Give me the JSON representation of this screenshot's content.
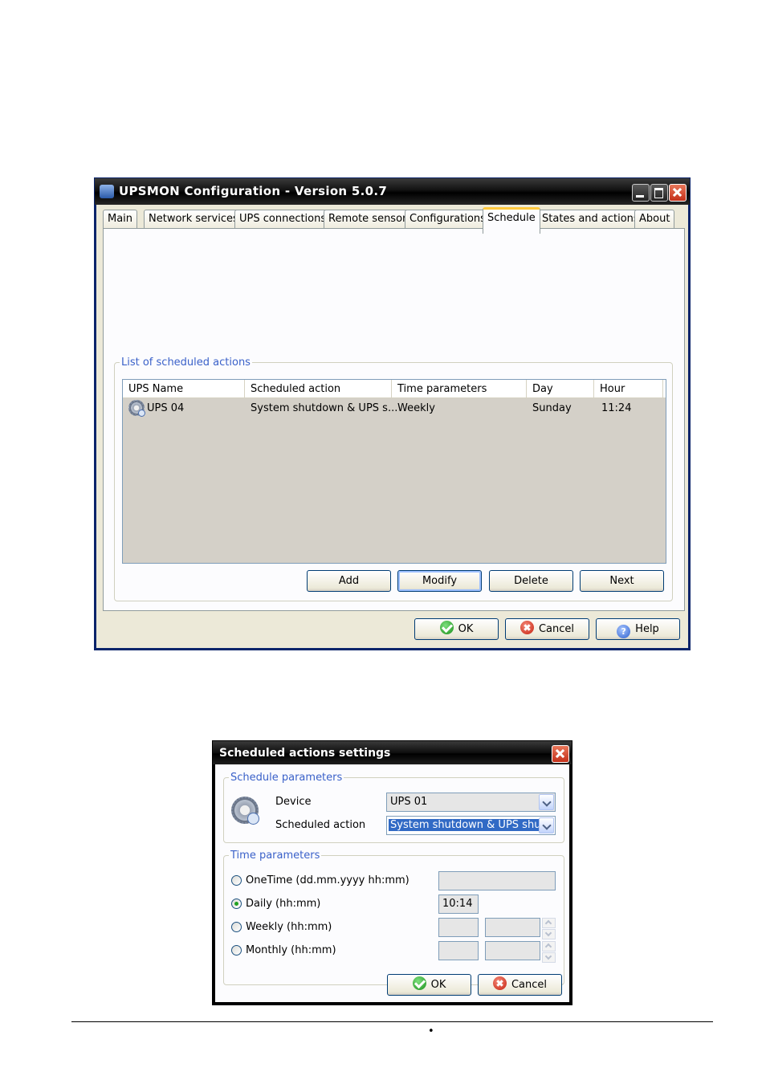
{
  "main_window": {
    "title": "UPSMON Configuration - Version 5.0.7",
    "tabs": [
      "Main",
      "Network services",
      "UPS connections",
      "Remote sensor",
      "Configurations",
      "Schedule",
      "States and actions",
      "About"
    ],
    "active_tab": "Schedule",
    "group_title": "List of scheduled actions",
    "columns": [
      "UPS Name",
      "Scheduled action",
      "Time parameters",
      "Day",
      "Hour"
    ],
    "rows": [
      {
        "icon": "gear-clock-icon",
        "ups_name": "UPS 04",
        "action": "System shutdown & UPS s...",
        "time_params": "Weekly",
        "day": "Sunday",
        "hour": "11:24"
      }
    ],
    "list_buttons": {
      "add": "Add",
      "modify": "Modify",
      "delete": "Delete",
      "next": "Next"
    },
    "footer_buttons": {
      "ok": "OK",
      "cancel": "Cancel",
      "help": "Help"
    },
    "colors": {
      "title_bar": "#000000",
      "tab_highlight": "#ffc83c",
      "group_legend": "#3a61c9"
    }
  },
  "settings_dialog": {
    "title": "Scheduled actions settings",
    "schedule_group": "Schedule parameters",
    "device_label": "Device",
    "device_value": "UPS 01",
    "action_label": "Scheduled action",
    "action_value": "System shutdown & UPS shutdo",
    "time_group": "Time parameters",
    "options": [
      {
        "label": "OneTime (dd.mm.yyyy hh:mm)",
        "checked": false,
        "value": ""
      },
      {
        "label": "Daily (hh:mm)",
        "checked": true,
        "value": "10:14"
      },
      {
        "label": "Weekly (hh:mm)",
        "checked": false,
        "value": ""
      },
      {
        "label": "Monthly (hh:mm)",
        "checked": false,
        "value": ""
      }
    ],
    "ok": "OK",
    "cancel": "Cancel"
  },
  "footer": {
    "bullet": "•"
  }
}
